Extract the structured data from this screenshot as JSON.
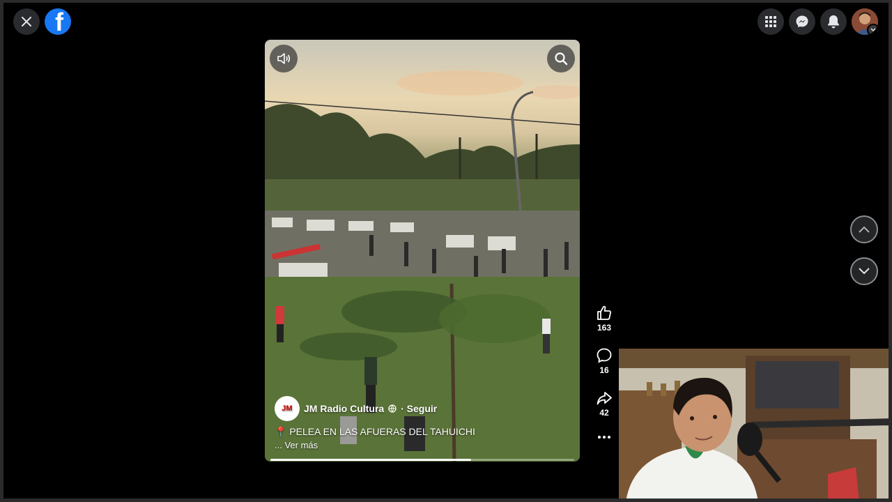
{
  "channel": {
    "name": "JM Radio Cultura",
    "follow": "· Seguir",
    "logo_text": "JM"
  },
  "caption": {
    "text": "📍 PELEA EN LAS AFUERAS DEL TAHUICHI",
    "more": "... Ver más"
  },
  "stats": {
    "likes": "163",
    "comments": "16",
    "shares": "42"
  },
  "video": {
    "progress": 0.66
  },
  "colors": {
    "brand": "#1877f2",
    "background": "#000000"
  },
  "icons": {
    "close": "close-icon",
    "facebook": "facebook-logo",
    "menu": "grid-icon",
    "messenger": "messenger-icon",
    "notifications": "bell-icon",
    "sound": "speaker-icon",
    "search": "search-icon",
    "like": "thumbs-up-icon",
    "comment": "comment-icon",
    "share": "share-icon",
    "more": "more-icon",
    "prev": "chevron-up-icon",
    "next": "chevron-down-icon"
  }
}
